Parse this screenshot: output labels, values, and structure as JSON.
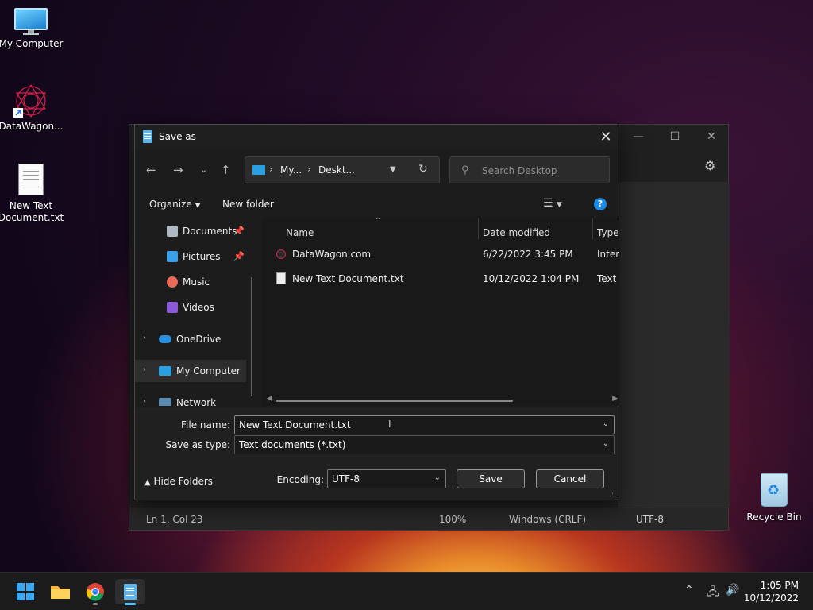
{
  "desktop": {
    "icons": [
      {
        "label": "My Computer"
      },
      {
        "label": "DataWagon..."
      },
      {
        "label": "New Text\nDocument.txt"
      },
      {
        "label": "Recycle Bin"
      }
    ]
  },
  "notepad": {
    "status": {
      "position": "Ln 1, Col 23",
      "zoom": "100%",
      "line_ending": "Windows (CRLF)",
      "encoding": "UTF-8"
    }
  },
  "dialog": {
    "title": "Save as",
    "address": {
      "segments": [
        "My...",
        "Deskt..."
      ]
    },
    "search_placeholder": "Search Desktop",
    "toolbar": {
      "organize": "Organize",
      "new_folder": "New folder"
    },
    "nav": [
      {
        "label": "Documents",
        "pinned": true
      },
      {
        "label": "Pictures",
        "pinned": true
      },
      {
        "label": "Music"
      },
      {
        "label": "Videos"
      },
      {
        "label": "OneDrive"
      },
      {
        "label": "My Computer",
        "selected": true
      },
      {
        "label": "Network"
      }
    ],
    "columns": [
      "Name",
      "Date modified",
      "Type"
    ],
    "files": [
      {
        "name": "DataWagon.com",
        "date": "6/22/2022 3:45 PM",
        "type": "Intern"
      },
      {
        "name": "New Text Document.txt",
        "date": "10/12/2022 1:04 PM",
        "type": "Text D"
      }
    ],
    "file_name_label": "File name:",
    "file_name_value": "New Text Document.txt",
    "save_type_label": "Save as type:",
    "save_type_value": "Text documents (*.txt)",
    "hide_folders": "Hide Folders",
    "encoding_label": "Encoding:",
    "encoding_value": "UTF-8",
    "save_button": "Save",
    "cancel_button": "Cancel"
  },
  "taskbar": {
    "time": "1:05 PM",
    "date": "10/12/2022"
  },
  "colors": {
    "accent": "#1e88e5",
    "dialog_bg": "#1c1c1c",
    "taskbar_bg": "#1c1c1c"
  }
}
